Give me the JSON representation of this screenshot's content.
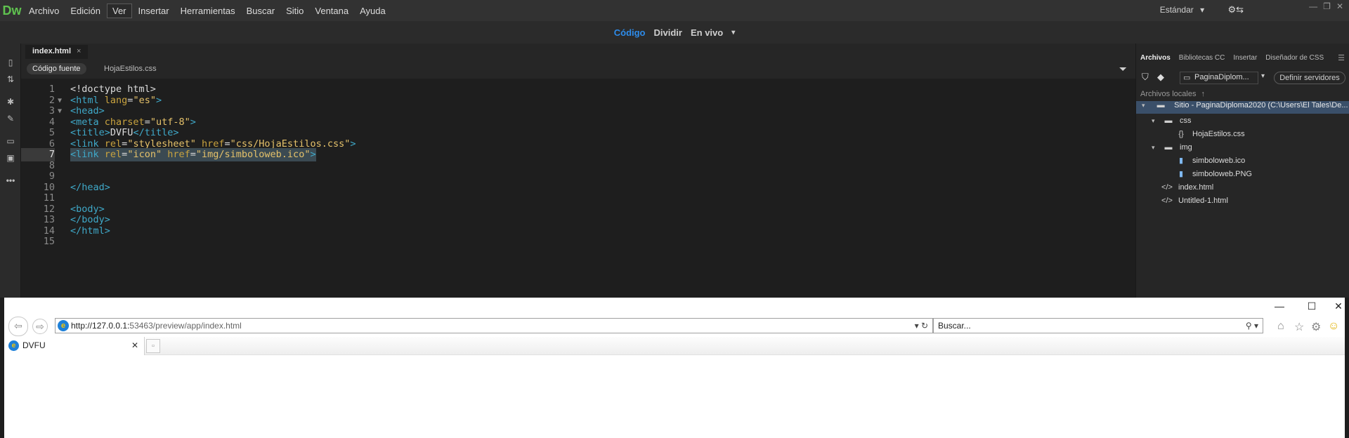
{
  "app": {
    "logo": "Dw"
  },
  "menu": [
    "Archivo",
    "Edición",
    "Ver",
    "Insertar",
    "Herramientas",
    "Buscar",
    "Sitio",
    "Ventana",
    "Ayuda"
  ],
  "workspace": {
    "label": "Estándar",
    "chevron": "▾"
  },
  "window_controls": {
    "minimize": "—",
    "restore": "❐",
    "close": "✕"
  },
  "views": {
    "codigo": "Código",
    "dividir": "Dividir",
    "envivo": "En vivo",
    "menu": "▾"
  },
  "doc_tab": {
    "name": "index.html",
    "close": "×"
  },
  "related_files": [
    "Código fuente",
    "HojaEstilos.css"
  ],
  "editor": {
    "current_line": 7,
    "lines": [
      {
        "n": "1",
        "fold": "",
        "code": "<!doctype html>"
      },
      {
        "n": "2",
        "fold": "▼",
        "code": "<html lang=\"es\">"
      },
      {
        "n": "3",
        "fold": "▼",
        "code": "<head>"
      },
      {
        "n": "4",
        "fold": "",
        "code": "<meta charset=\"utf-8\">"
      },
      {
        "n": "5",
        "fold": "",
        "code": "<title>DVFU</title>"
      },
      {
        "n": "6",
        "fold": "",
        "code": "<link rel=\"stylesheet\" href=\"css/HojaEstilos.css\">"
      },
      {
        "n": "7",
        "fold": "",
        "code": "<link rel=\"icon\" href=\"img/simboloweb.ico\">"
      },
      {
        "n": "8",
        "fold": "",
        "code": ""
      },
      {
        "n": "9",
        "fold": "",
        "code": ""
      },
      {
        "n": "10",
        "fold": "",
        "code": "</head>"
      },
      {
        "n": "11",
        "fold": "",
        "code": ""
      },
      {
        "n": "12",
        "fold": "",
        "code": "<body>"
      },
      {
        "n": "13",
        "fold": "",
        "code": "</body>"
      },
      {
        "n": "14",
        "fold": "",
        "code": "</html>"
      },
      {
        "n": "15",
        "fold": "",
        "code": ""
      }
    ]
  },
  "panel": {
    "tabs": [
      "Archivos",
      "Bibliotecas CC",
      "Insertar",
      "Diseñador de CSS"
    ],
    "site_select": "PaginaDiplom...",
    "define_servers": "Definir servidores",
    "local_files": "Archivos locales",
    "tree_root": "Sitio - PaginaDiploma2020 (C:\\Users\\El Tales\\De...",
    "tree": {
      "css": "css",
      "hoja": "HojaEstilos.css",
      "img": "img",
      "ico": "simboloweb.ico",
      "png": "simboloweb.PNG",
      "index": "index.html",
      "untitled": "Untitled-1.html"
    }
  },
  "browser": {
    "address_host": "http://127.0.0.1:",
    "address_rest": "53463/preview/app/index.html",
    "search_placeholder": "Buscar...",
    "tab_title": "DVFU",
    "tab_close": "✕"
  },
  "colors": {
    "accent": "#2d8ceb",
    "dw_green": "#5fc24f",
    "tree_selection": "#3a4f69"
  }
}
